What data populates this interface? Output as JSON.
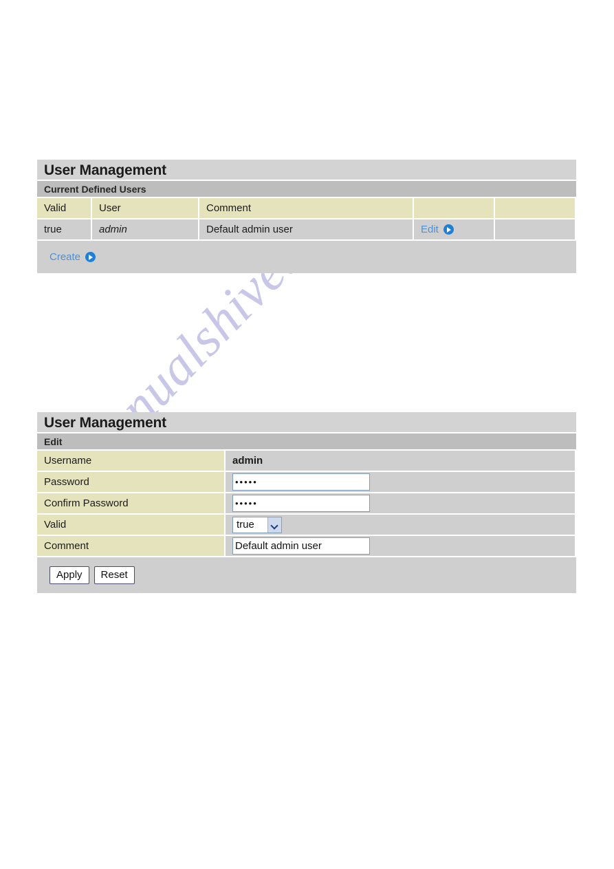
{
  "watermark": {
    "text": "manualshive.com",
    "color": "#c9c7e8"
  },
  "panels": {
    "users": {
      "title": "User Management",
      "subtitle": "Current Defined Users",
      "columns": [
        "Valid",
        "User",
        "Comment",
        "",
        ""
      ],
      "rows": [
        {
          "valid": "true",
          "user": "admin",
          "comment": "Default admin user",
          "action_label": "Edit",
          "blank": ""
        }
      ],
      "create_label": "Create"
    },
    "edit": {
      "title": "User Management",
      "subtitle": "Edit",
      "fields": {
        "username_label": "Username",
        "username_value": "admin",
        "password_label": "Password",
        "password_value": "•••••",
        "confirm_label": "Confirm Password",
        "confirm_value": "•••••",
        "valid_label": "Valid",
        "valid_value": "true",
        "valid_options": [
          "true",
          "false"
        ],
        "comment_label": "Comment",
        "comment_value": "Default admin user"
      },
      "apply_label": "Apply",
      "reset_label": "Reset"
    }
  },
  "colors": {
    "title_bar": "#d3d3d3",
    "subtitle_bar": "#bdbdbd",
    "header_cell": "#e4e3bb",
    "data_cell": "#cfcfcf",
    "link": "#4f8fd4",
    "arrow_icon": "#1f7fd4"
  }
}
